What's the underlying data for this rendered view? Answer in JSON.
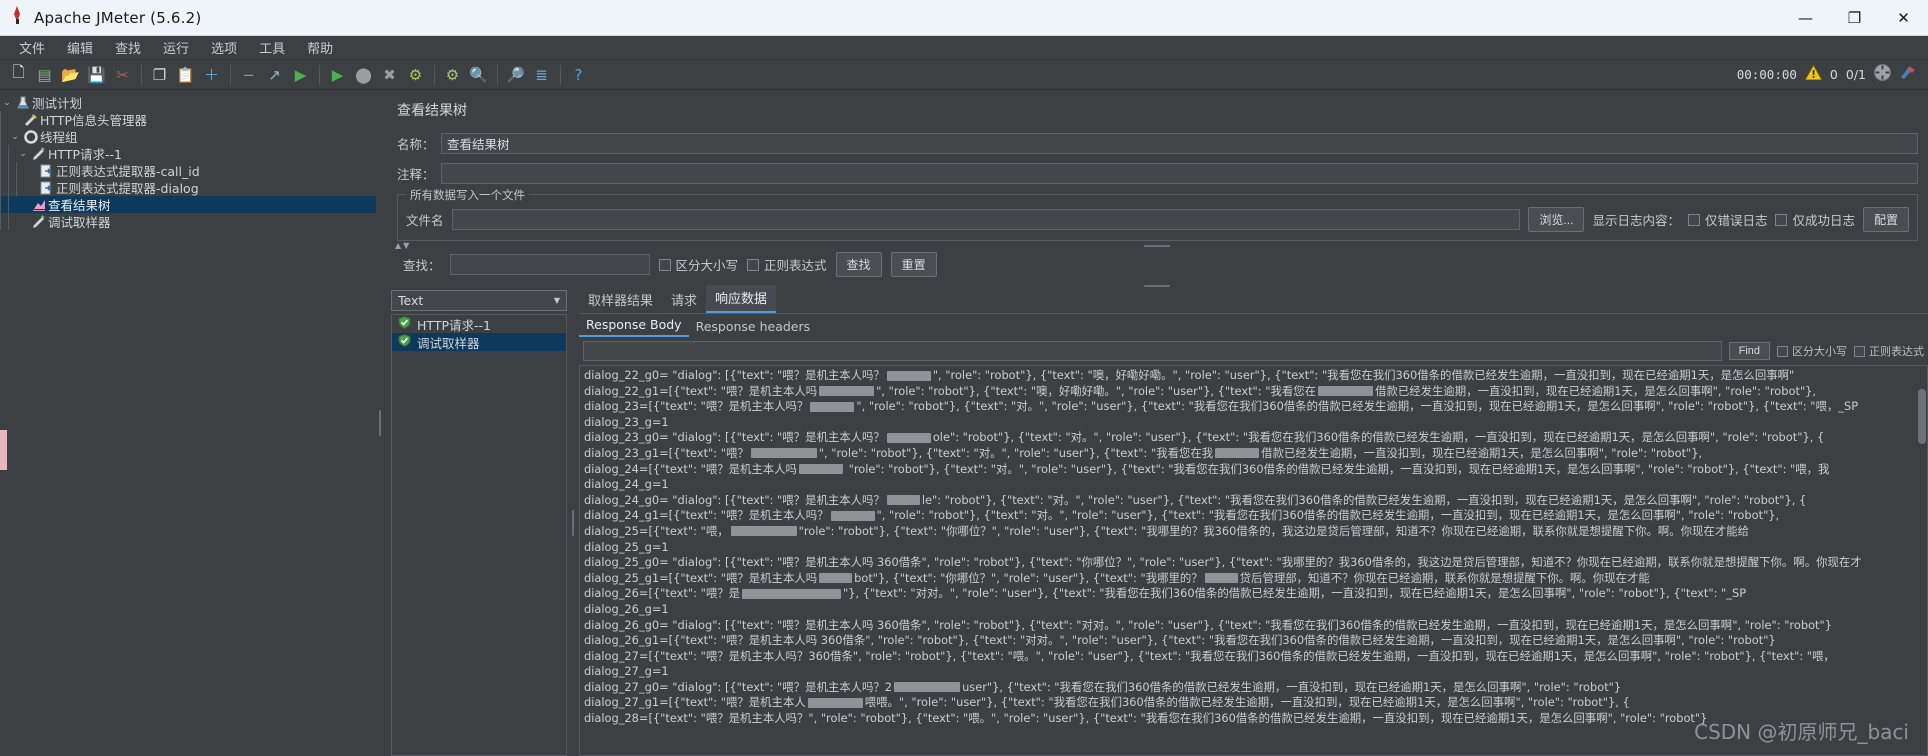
{
  "window": {
    "title": "Apache JMeter (5.6.2)",
    "app_icon": "jmeter-feather-icon",
    "minimize": "—",
    "maximize": "❐",
    "close": "✕"
  },
  "menu": {
    "items": [
      {
        "label": "文件",
        "name": "menu-file"
      },
      {
        "label": "编辑",
        "name": "menu-edit"
      },
      {
        "label": "查找",
        "name": "menu-search"
      },
      {
        "label": "运行",
        "name": "menu-run"
      },
      {
        "label": "选项",
        "name": "menu-options"
      },
      {
        "label": "工具",
        "name": "menu-tools"
      },
      {
        "label": "帮助",
        "name": "menu-help"
      }
    ]
  },
  "toolbar": {
    "buttons": [
      {
        "name": "new-icon",
        "glyph": "🗋",
        "color": "#e9e9e2"
      },
      {
        "name": "templates-icon",
        "glyph": "▤",
        "color": "#7fb77e"
      },
      {
        "name": "open-icon",
        "glyph": "📂",
        "color": "#d9a74a"
      },
      {
        "name": "save-icon",
        "glyph": "💾",
        "color": "#cfd3d6"
      },
      {
        "name": "cut-icon",
        "glyph": "✂",
        "color": "#d45050"
      },
      {
        "name": "copy-icon",
        "glyph": "❐",
        "color": "#d2d6d9"
      },
      {
        "name": "paste-icon",
        "glyph": "📋",
        "color": "#d6b36a"
      },
      {
        "name": "expand-all-icon",
        "glyph": "＋",
        "color": "#5e9fd4"
      },
      {
        "name": "collapse-all-icon",
        "glyph": "−",
        "color": "#5e9fd4"
      },
      {
        "name": "toggle-icon",
        "glyph": "↗",
        "color": "#8fb5d6"
      },
      {
        "name": "start-icon",
        "glyph": "▶",
        "color": "#4caf50"
      },
      {
        "name": "start-no-pause-icon",
        "glyph": "▶",
        "color": "#4caf50"
      },
      {
        "name": "stop-icon",
        "glyph": "⬤",
        "color": "#9a9ea1"
      },
      {
        "name": "shutdown-icon",
        "glyph": "✖",
        "color": "#9a9ea1"
      },
      {
        "name": "clear-icon",
        "glyph": "⚙",
        "color": "#9fcc6a"
      },
      {
        "name": "clear-all-icon",
        "glyph": "⚙",
        "color": "#9fcc6a"
      },
      {
        "name": "search-icon",
        "glyph": "🔍",
        "color": "#c9a24a"
      },
      {
        "name": "reset-search-icon",
        "glyph": "🔎",
        "color": "#d07b3c"
      },
      {
        "name": "function-helper-icon",
        "glyph": "≣",
        "color": "#6ea8d8"
      },
      {
        "name": "help-icon",
        "glyph": "?",
        "color": "#5e9fd4"
      }
    ],
    "timer": "00:00:00",
    "warning_icon": "warning-triangle-icon",
    "warning_count": "0",
    "thread_count": "0/1",
    "threads_icon": "running-threads-icon",
    "clear_icon": "clear-gc-icon"
  },
  "tree": {
    "nodes": [
      {
        "label": "测试计划",
        "icon": "test-plan-icon",
        "depth": 0,
        "twisty": "⌄",
        "selected": false,
        "name": "tree-node-test-plan"
      },
      {
        "label": "HTTP信息头管理器",
        "icon": "header-manager-icon",
        "depth": 1,
        "twisty": "",
        "selected": false,
        "name": "tree-node-http-header-manager"
      },
      {
        "label": "线程组",
        "icon": "thread-group-icon",
        "depth": 1,
        "twisty": "⌄",
        "selected": false,
        "name": "tree-node-thread-group"
      },
      {
        "label": "HTTP请求--1",
        "icon": "http-request-icon",
        "depth": 2,
        "twisty": "⌄",
        "selected": false,
        "name": "tree-node-http-request-1"
      },
      {
        "label": "正则表达式提取器-call_id",
        "icon": "regex-extractor-icon",
        "depth": 3,
        "twisty": "",
        "selected": false,
        "name": "tree-node-regex-extractor-call-id"
      },
      {
        "label": "正则表达式提取器-dialog",
        "icon": "regex-extractor-icon",
        "depth": 3,
        "twisty": "",
        "selected": false,
        "name": "tree-node-regex-extractor-dialog"
      },
      {
        "label": "查看结果树",
        "icon": "view-results-tree-icon",
        "depth": 2,
        "twisty": "",
        "selected": true,
        "name": "tree-node-view-results-tree"
      },
      {
        "label": "调试取样器",
        "icon": "debug-sampler-icon",
        "depth": 2,
        "twisty": "",
        "selected": false,
        "name": "tree-node-debug-sampler"
      }
    ]
  },
  "panel": {
    "title": "查看结果树",
    "name_label": "名称：",
    "name_value": "查看结果树",
    "comment_label": "注释：",
    "comment_value": "",
    "file_group_legend": "所有数据写入一个文件",
    "filename_label": "文件名",
    "filename_value": "",
    "browse_button": "浏览...",
    "log_display_label": "显示日志内容：",
    "errors_only_label": "仅错误日志",
    "success_only_label": "仅成功日志",
    "configure_button": "配置"
  },
  "search": {
    "label": "查找：",
    "value": "",
    "case_sensitive_label": "区分大小写",
    "regex_label": "正则表达式",
    "find_button": "查找",
    "reset_button": "重置"
  },
  "results": {
    "renderer_selected": "Text",
    "items": [
      {
        "label": "HTTP请求--1",
        "status": "success",
        "selected": false,
        "name": "result-item-http-request-1"
      },
      {
        "label": "调试取样器",
        "status": "success",
        "selected": true,
        "name": "result-item-debug-sampler"
      }
    ],
    "tabs": [
      {
        "label": "取样器结果",
        "active": false,
        "name": "tab-sampler-result"
      },
      {
        "label": "请求",
        "active": false,
        "name": "tab-request"
      },
      {
        "label": "响应数据",
        "active": true,
        "name": "tab-response-data"
      }
    ],
    "subtabs": [
      {
        "label": "Response Body",
        "active": true,
        "name": "subtab-response-body"
      },
      {
        "label": "Response headers",
        "active": false,
        "name": "subtab-response-headers"
      }
    ],
    "find": {
      "value": "",
      "button": "Find",
      "case_sensitive_label": "区分大小写",
      "regex_label": "正则表达式"
    }
  },
  "body": {
    "lines": [
      "dialog_22_g0= \"dialog\": [{\"text\": \"喂？是机主本人吗？████\", \"role\": \"robot\"}, {\"text\": \"噢，好嘞好嘞。\", \"role\": \"user\"}, {\"text\": \"我看您在我们360借条的借款已经发生逾期，一直没扣到，现在已经逾期1天，是怎么回事啊\"",
      "dialog_22_g1=[{\"text\": \"喂？是机主本人吗█████\", \"role\": \"robot\"}, {\"text\": \"噢，好嘞好嘞。\", \"role\": \"user\"}, {\"text\": \"我看您在█████借款已经发生逾期，一直没扣到，现在已经逾期1天，是怎么回事啊\", \"role\": \"robot\"},",
      "dialog_23=[{\"text\": \"喂？是机主本人吗？████\", \"role\": \"robot\"}, {\"text\": \"对。\", \"role\": \"user\"}, {\"text\": \"我看您在我们360借条的借款已经发生逾期，一直没扣到，现在已经逾期1天，是怎么回事啊\", \"role\": \"robot\"}, {\"text\": \"喂，_SP",
      "dialog_23_g=1",
      "dialog_23_g0= \"dialog\": [{\"text\": \"喂？是机主本人吗？████ole\": \"robot\"}, {\"text\": \"对。\", \"role\": \"user\"}, {\"text\": \"我看您在我们360借条的借款已经发生逾期，一直没扣到，现在已经逾期1天，是怎么回事啊\", \"role\": \"robot\"}, {",
      "dialog_23_g1=[{\"text\": \"喂？██████\", \"role\": \"robot\"}, {\"text\": \"对。\", \"role\": \"user\"}, {\"text\": \"我看您在我████借款已经发生逾期，一直没扣到，现在已经逾期1天，是怎么回事啊\", \"role\": \"robot\"},",
      "dialog_24=[{\"text\": \"喂？是机主本人吗████ \"role\": \"robot\"}, {\"text\": \"对。\", \"role\": \"user\"}, {\"text\": \"我看您在我们360借条的借款已经发生逾期，一直没扣到，现在已经逾期1天，是怎么回事啊\", \"role\": \"robot\"}, {\"text\": \"喂，我",
      "dialog_24_g=1",
      "dialog_24_g0= \"dialog\": [{\"text\": \"喂？是机主本人吗？███le\": \"robot\"}, {\"text\": \"对。\", \"role\": \"user\"}, {\"text\": \"我看您在我们360借条的借款已经发生逾期，一直没扣到，现在已经逾期1天，是怎么回事啊\", \"role\": \"robot\"}, {",
      "dialog_24_g1=[{\"text\": \"喂？是机主本人吗？████\", \"role\": \"robot\"}, {\"text\": \"对。\", \"role\": \"user\"}, {\"text\": \"我看您在我们360借条的借款已经发生逾期，一直没扣到，现在已经逾期1天，是怎么回事啊\", \"role\": \"robot\"},",
      "dialog_25=[{\"text\": \"喂，██████\"role\": \"robot\"}, {\"text\": \"你哪位？\", \"role\": \"user\"}, {\"text\": \"我哪里的？我360借条的，我这边是贷后管理部，知道不？你现在已经逾期，联系你就是想提醒下你。啊。你现在才能给",
      "dialog_25_g=1",
      "dialog_25_g0= \"dialog\": [{\"text\": \"喂？是机主本人吗 360借条\", \"role\": \"robot\"}, {\"text\": \"你哪位？\", \"role\": \"user\"}, {\"text\": \"我哪里的？我360借条的，我这边是贷后管理部，知道不？你现在已经逾期，联系你就是想提醒下你。啊。你现在才",
      "dialog_25_g1=[{\"text\": \"喂？是机主本人吗███bot\"}, {\"text\": \"你哪位？\", \"role\": \"user\"}, {\"text\": \"我哪里的？███贷后管理部，知道不？你现在已经逾期，联系你就是想提醒下你。啊。你现在才能",
      "dialog_26=[{\"text\": \"喂？是█████████\"}, {\"text\": \"对对。\", \"role\": \"user\"}, {\"text\": \"我看您在我们360借条的借款已经发生逾期，一直没扣到，现在已经逾期1天，是怎么回事啊\", \"role\": \"robot\"}, {\"text\": \"_SP",
      "dialog_26_g=1",
      "dialog_26_g0= \"dialog\": [{\"text\": \"喂？是机主本人吗 360借条\", \"role\": \"robot\"}, {\"text\": \"对对。\", \"role\": \"user\"}, {\"text\": \"我看您在我们360借条的借款已经发生逾期，一直没扣到，现在已经逾期1天，是怎么回事啊\", \"role\": \"robot\"}",
      "dialog_26_g1=[{\"text\": \"喂？是机主本人吗 360借条\", \"role\": \"robot\"}, {\"text\": \"对对。\", \"role\": \"user\"}, {\"text\": \"我看您在我们360借条的借款已经发生逾期，一直没扣到，现在已经逾期1天，是怎么回事啊\", \"role\": \"robot\"}",
      "dialog_27=[{\"text\": \"喂？是机主本人吗？360借条\", \"role\": \"robot\"}, {\"text\": \"喂。\", \"role\": \"user\"}, {\"text\": \"我看您在我们360借条的借款已经发生逾期，一直没扣到，现在已经逾期1天，是怎么回事啊\", \"role\": \"robot\"}, {\"text\": \"喂，",
      "dialog_27_g=1",
      "dialog_27_g0= \"dialog\": [{\"text\": \"喂？是机主本人吗？2██████user\"}, {\"text\": \"我看您在我们360借条的借款已经发生逾期，一直没扣到，现在已经逾期1天，是怎么回事啊\", \"role\": \"robot\"}",
      "dialog_27_g1=[{\"text\": \"喂？是机主本人█████喂喂。\", \"role\": \"user\"}, {\"text\": \"我看您在我们360借条的借款已经发生逾期，一直没扣到，现在已经逾期1天，是怎么回事啊\", \"role\": \"robot\"}, {",
      "dialog_28=[{\"text\": \"喂？是机主本人吗？\", \"role\": \"robot\"}, {\"text\": \"喂。\", \"role\": \"user\"}, {\"text\": \"我看您在我们360借条的借款已经发生逾期，一直没扣到，现在已经逾期1天，是怎么回事啊\", \"role\": \"robot\"}"
    ],
    "watermark": "CSDN @初原师兄_baci"
  }
}
